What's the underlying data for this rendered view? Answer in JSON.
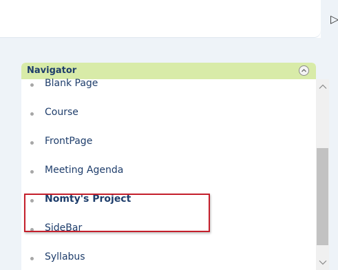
{
  "top_glyph": "▷",
  "navigator": {
    "title": "Navigator",
    "items": [
      {
        "label": "Blank Page",
        "selected": false
      },
      {
        "label": "Course",
        "selected": false
      },
      {
        "label": "FrontPage",
        "selected": false
      },
      {
        "label": "Meeting Agenda",
        "selected": false
      },
      {
        "label": "Nomty's Project",
        "selected": true
      },
      {
        "label": "SideBar",
        "selected": false
      },
      {
        "label": "Syllabus",
        "selected": false
      }
    ]
  },
  "colors": {
    "header_bg": "#d8eba8",
    "link": "#1e3d6b",
    "highlight": "#c41e2a",
    "panel_bg": "#eef3f8"
  },
  "icons": {
    "collapse": "chevron-up-circle-icon",
    "scroll_up": "chevron-up-icon",
    "scroll_down": "chevron-down-icon"
  }
}
